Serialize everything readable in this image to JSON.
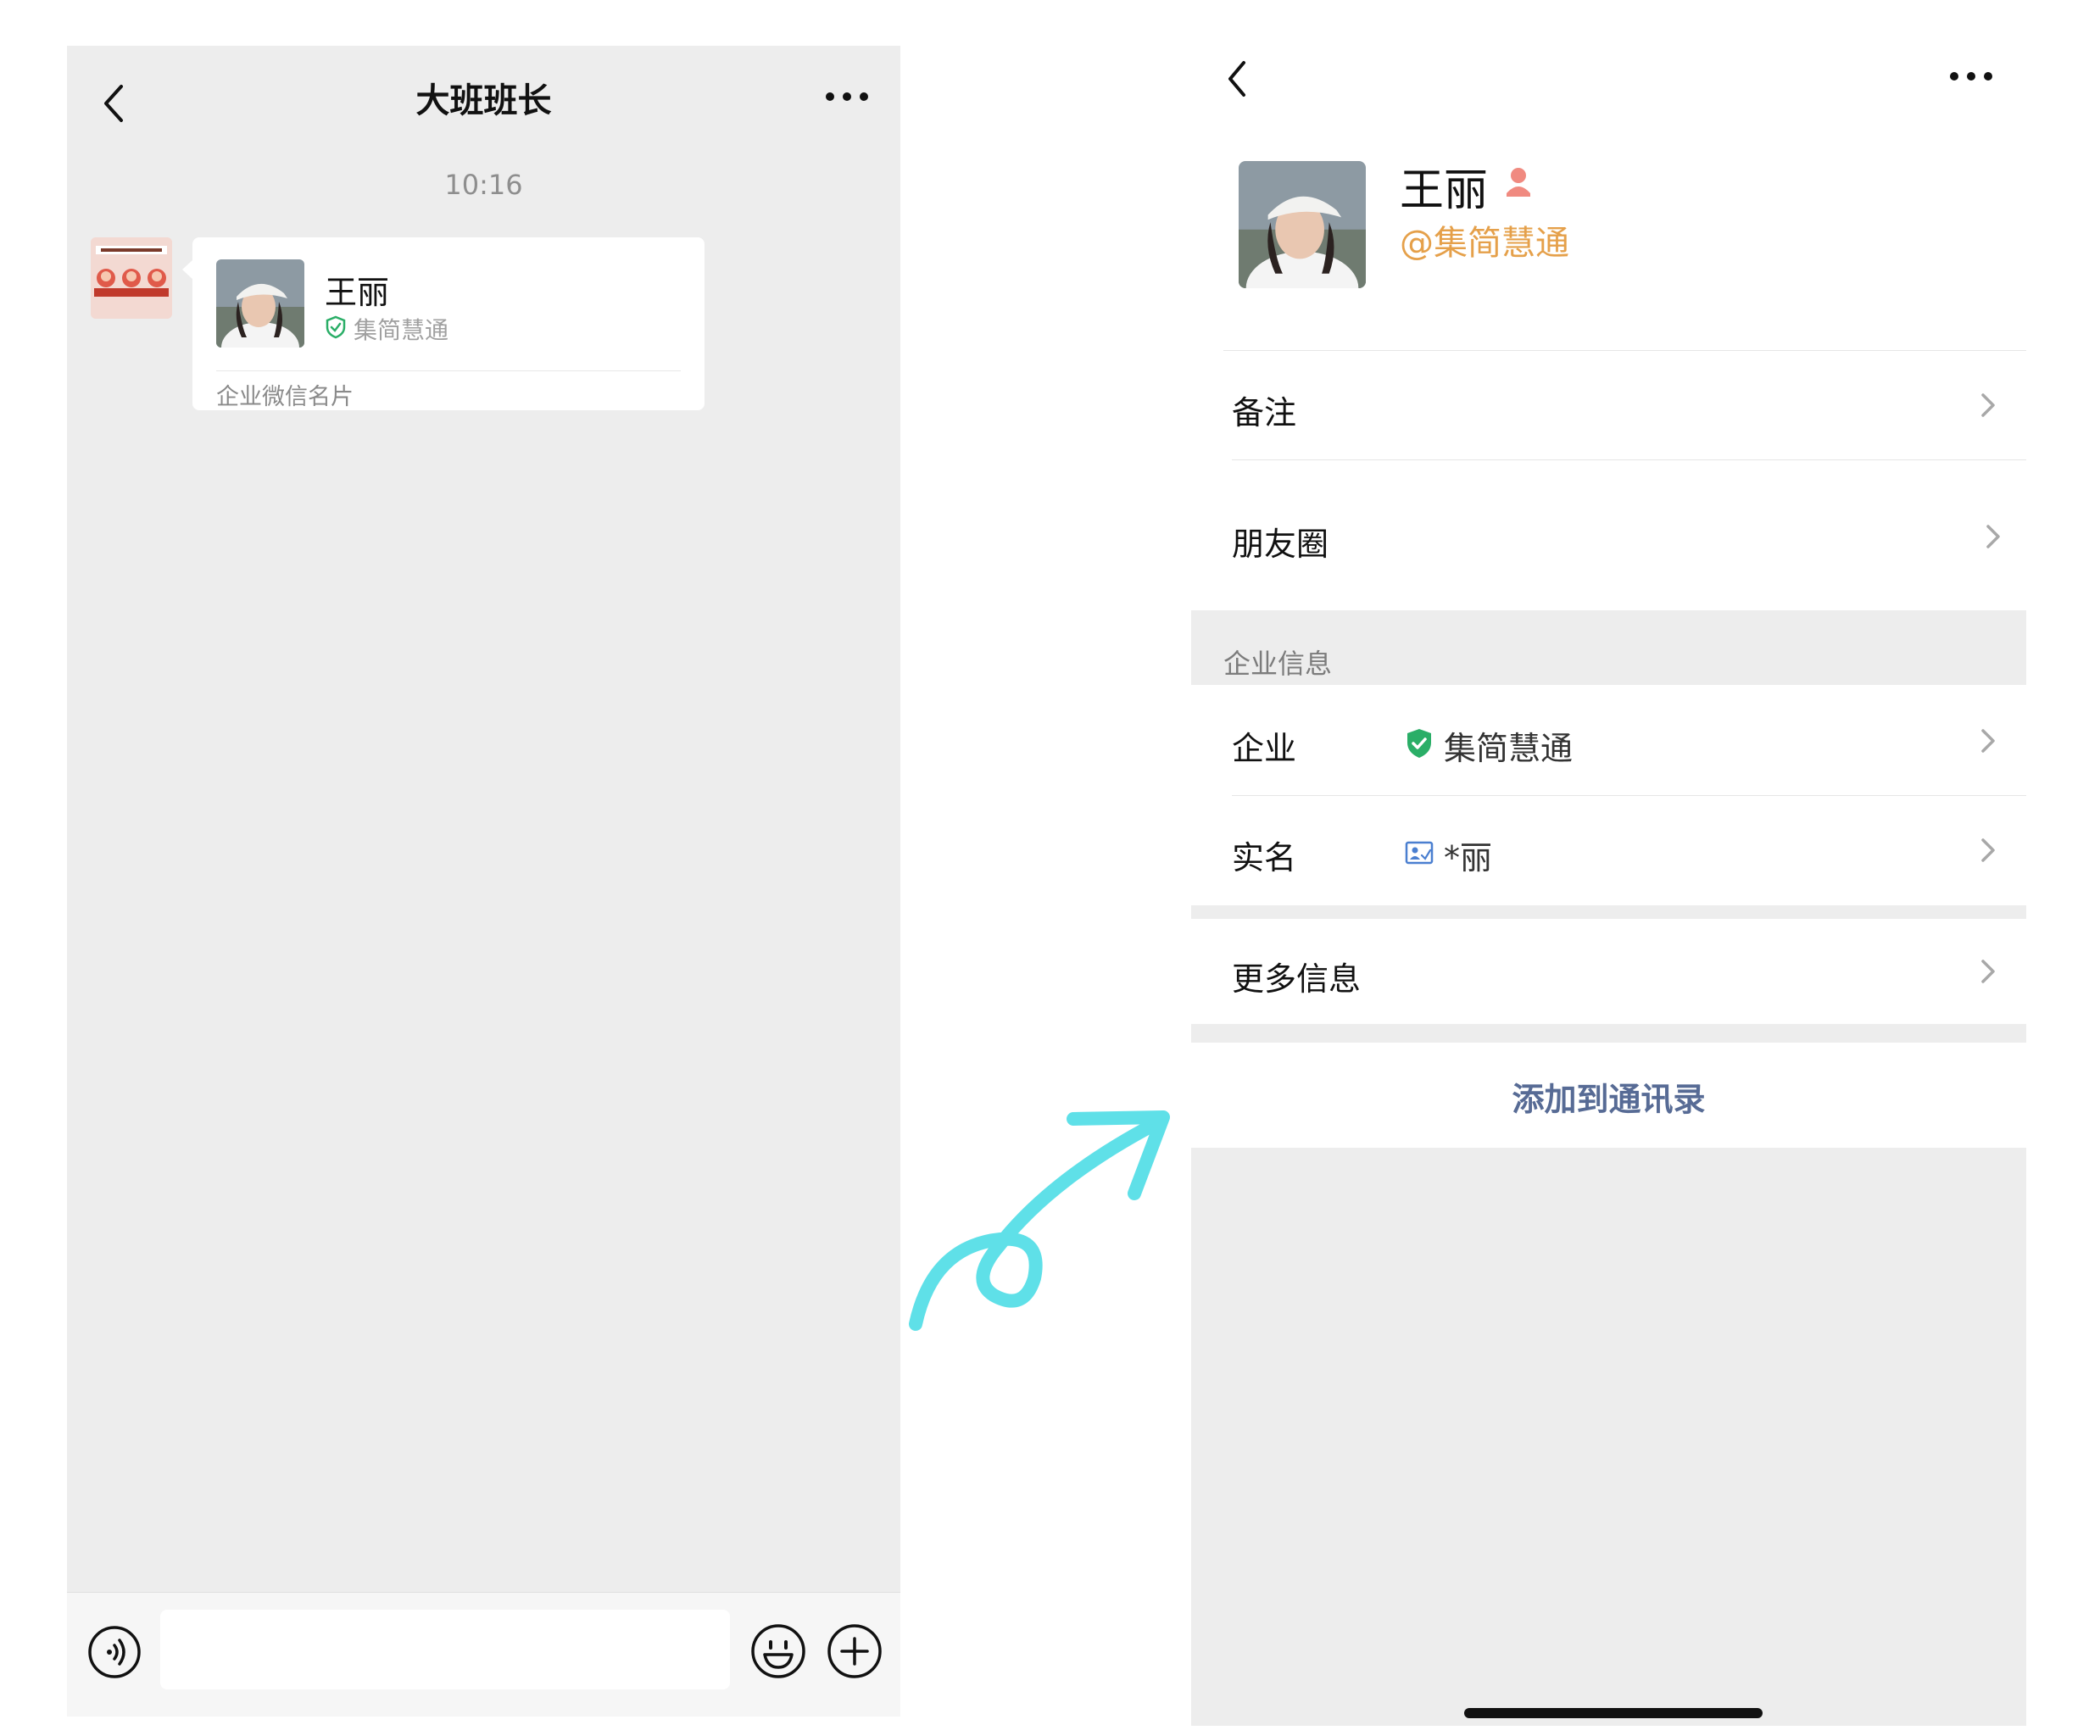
{
  "chat": {
    "title": "大班班长",
    "time": "10:16",
    "card": {
      "name": "王丽",
      "company": "集简慧通",
      "type_label": "企业微信名片"
    }
  },
  "profile": {
    "name": "王丽",
    "company_handle": "@集简慧通",
    "rows": {
      "remark": "备注",
      "moments": "朋友圈",
      "section_title": "企业信息",
      "company_label": "企业",
      "company_value": "集简慧通",
      "realname_label": "实名",
      "realname_value": "*丽",
      "more_info": "更多信息"
    },
    "add_contact": "添加到通讯录"
  },
  "colors": {
    "chat_bg": "#ededed",
    "link_blue": "#576b95",
    "company_orange": "#e5a04a",
    "verified_green": "#2aae67",
    "arrow_cyan": "#5fe0e8"
  },
  "icons": [
    "back-icon",
    "more-icon",
    "verified-shield-icon",
    "voice-icon",
    "emoji-icon",
    "plus-icon",
    "female-icon",
    "chevron-right-icon",
    "id-card-icon"
  ]
}
